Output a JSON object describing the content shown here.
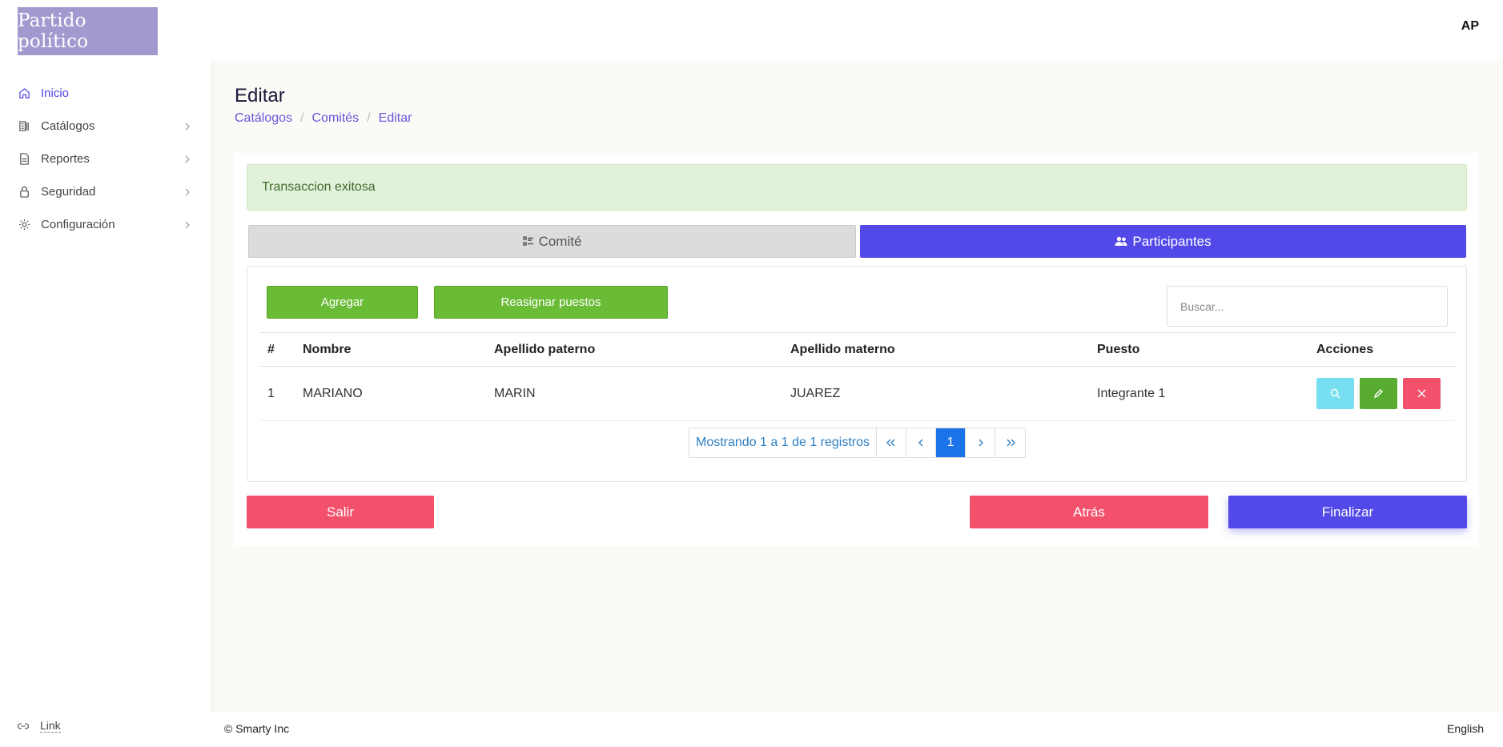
{
  "brand": {
    "logo_text": "Partido político",
    "accent": "#4f46e5"
  },
  "sidebar": {
    "items": [
      {
        "label": "Inicio",
        "icon": "home-icon",
        "active": true
      },
      {
        "label": "Catálogos",
        "icon": "catalog-icon",
        "has_submenu": true
      },
      {
        "label": "Reportes",
        "icon": "report-icon",
        "has_submenu": true
      },
      {
        "label": "Seguridad",
        "icon": "lock-icon",
        "has_submenu": true
      },
      {
        "label": "Configuración",
        "icon": "gear-icon",
        "has_submenu": true
      }
    ],
    "bottom_link": {
      "label": "Link",
      "icon": "link-icon"
    }
  },
  "topbar": {
    "avatar": "AP"
  },
  "header": {
    "title": "Editar",
    "breadcrumb": [
      "Catálogos",
      "Comités",
      "Editar"
    ]
  },
  "alert": {
    "text": "Transaccion exitosa",
    "color": "#e2f1d9"
  },
  "tabs": [
    {
      "label": "Comité",
      "icon": "checklist-icon",
      "active": false
    },
    {
      "label": "Participantes",
      "icon": "users-icon",
      "active": true
    }
  ],
  "toolbar": {
    "add_label": "Agregar",
    "reassign_label": "Reasignar puestos",
    "search_placeholder": "Buscar..."
  },
  "table": {
    "columns": [
      "#",
      "Nombre",
      "Apellido paterno",
      "Apellido materno",
      "Puesto",
      "Acciones"
    ],
    "rows": [
      {
        "num": "1",
        "nombre": "MARIANO",
        "apellido_paterno": "MARIN",
        "apellido_materno": "JUAREZ",
        "puesto": "Integrante 1"
      }
    ]
  },
  "pagination": {
    "info": "Mostrando 1 a 1 de 1 registros",
    "first": "«",
    "prev": "‹",
    "current": "1",
    "next": "›",
    "last": "»"
  },
  "footer_buttons": {
    "exit": "Salir",
    "back": "Atrás",
    "finish": "Finalizar"
  },
  "footer": {
    "copyright": "© Smarty Inc",
    "language": "English"
  }
}
